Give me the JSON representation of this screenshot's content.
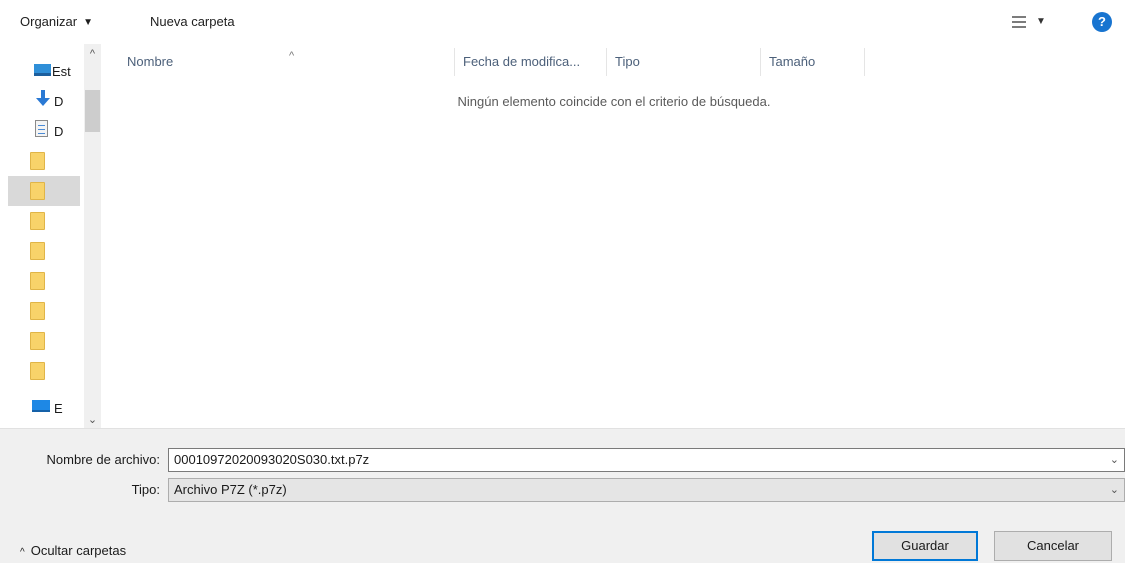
{
  "toolbar": {
    "organize_label": "Organizar",
    "new_folder_label": "Nueva carpeta",
    "help_symbol": "?"
  },
  "nav": {
    "items": [
      {
        "label": "Est",
        "icon": "desktop-icon"
      },
      {
        "label": "D",
        "icon": "download-icon"
      },
      {
        "label": "D",
        "icon": "document-icon"
      },
      {
        "label": "",
        "icon": "folder-icon"
      },
      {
        "label": "",
        "icon": "folder-icon",
        "selected": true
      },
      {
        "label": "",
        "icon": "folder-icon"
      },
      {
        "label": "",
        "icon": "folder-icon"
      },
      {
        "label": "",
        "icon": "folder-icon"
      },
      {
        "label": "",
        "icon": "folder-icon"
      },
      {
        "label": "",
        "icon": "folder-icon"
      },
      {
        "label": "",
        "icon": "folder-icon"
      },
      {
        "label": "E",
        "icon": "this-pc-icon"
      }
    ]
  },
  "file_list": {
    "columns": [
      "Nombre",
      "Fecha de modifica...",
      "Tipo",
      "Tamaño"
    ],
    "empty_message": "Ningún elemento coincide con el criterio de búsqueda."
  },
  "form": {
    "filename_label": "Nombre de archivo:",
    "filename_value": "00010972020093020S030.txt.p7z",
    "type_label": "Tipo:",
    "type_value": "Archivo P7Z (*.p7z)"
  },
  "footer": {
    "hide_folders_label": "Ocultar carpetas",
    "save_label": "Guardar",
    "cancel_label": "Cancelar"
  },
  "colors": {
    "accent": "#0078d7",
    "folder": "#f8d36a",
    "help": "#1874d0"
  }
}
